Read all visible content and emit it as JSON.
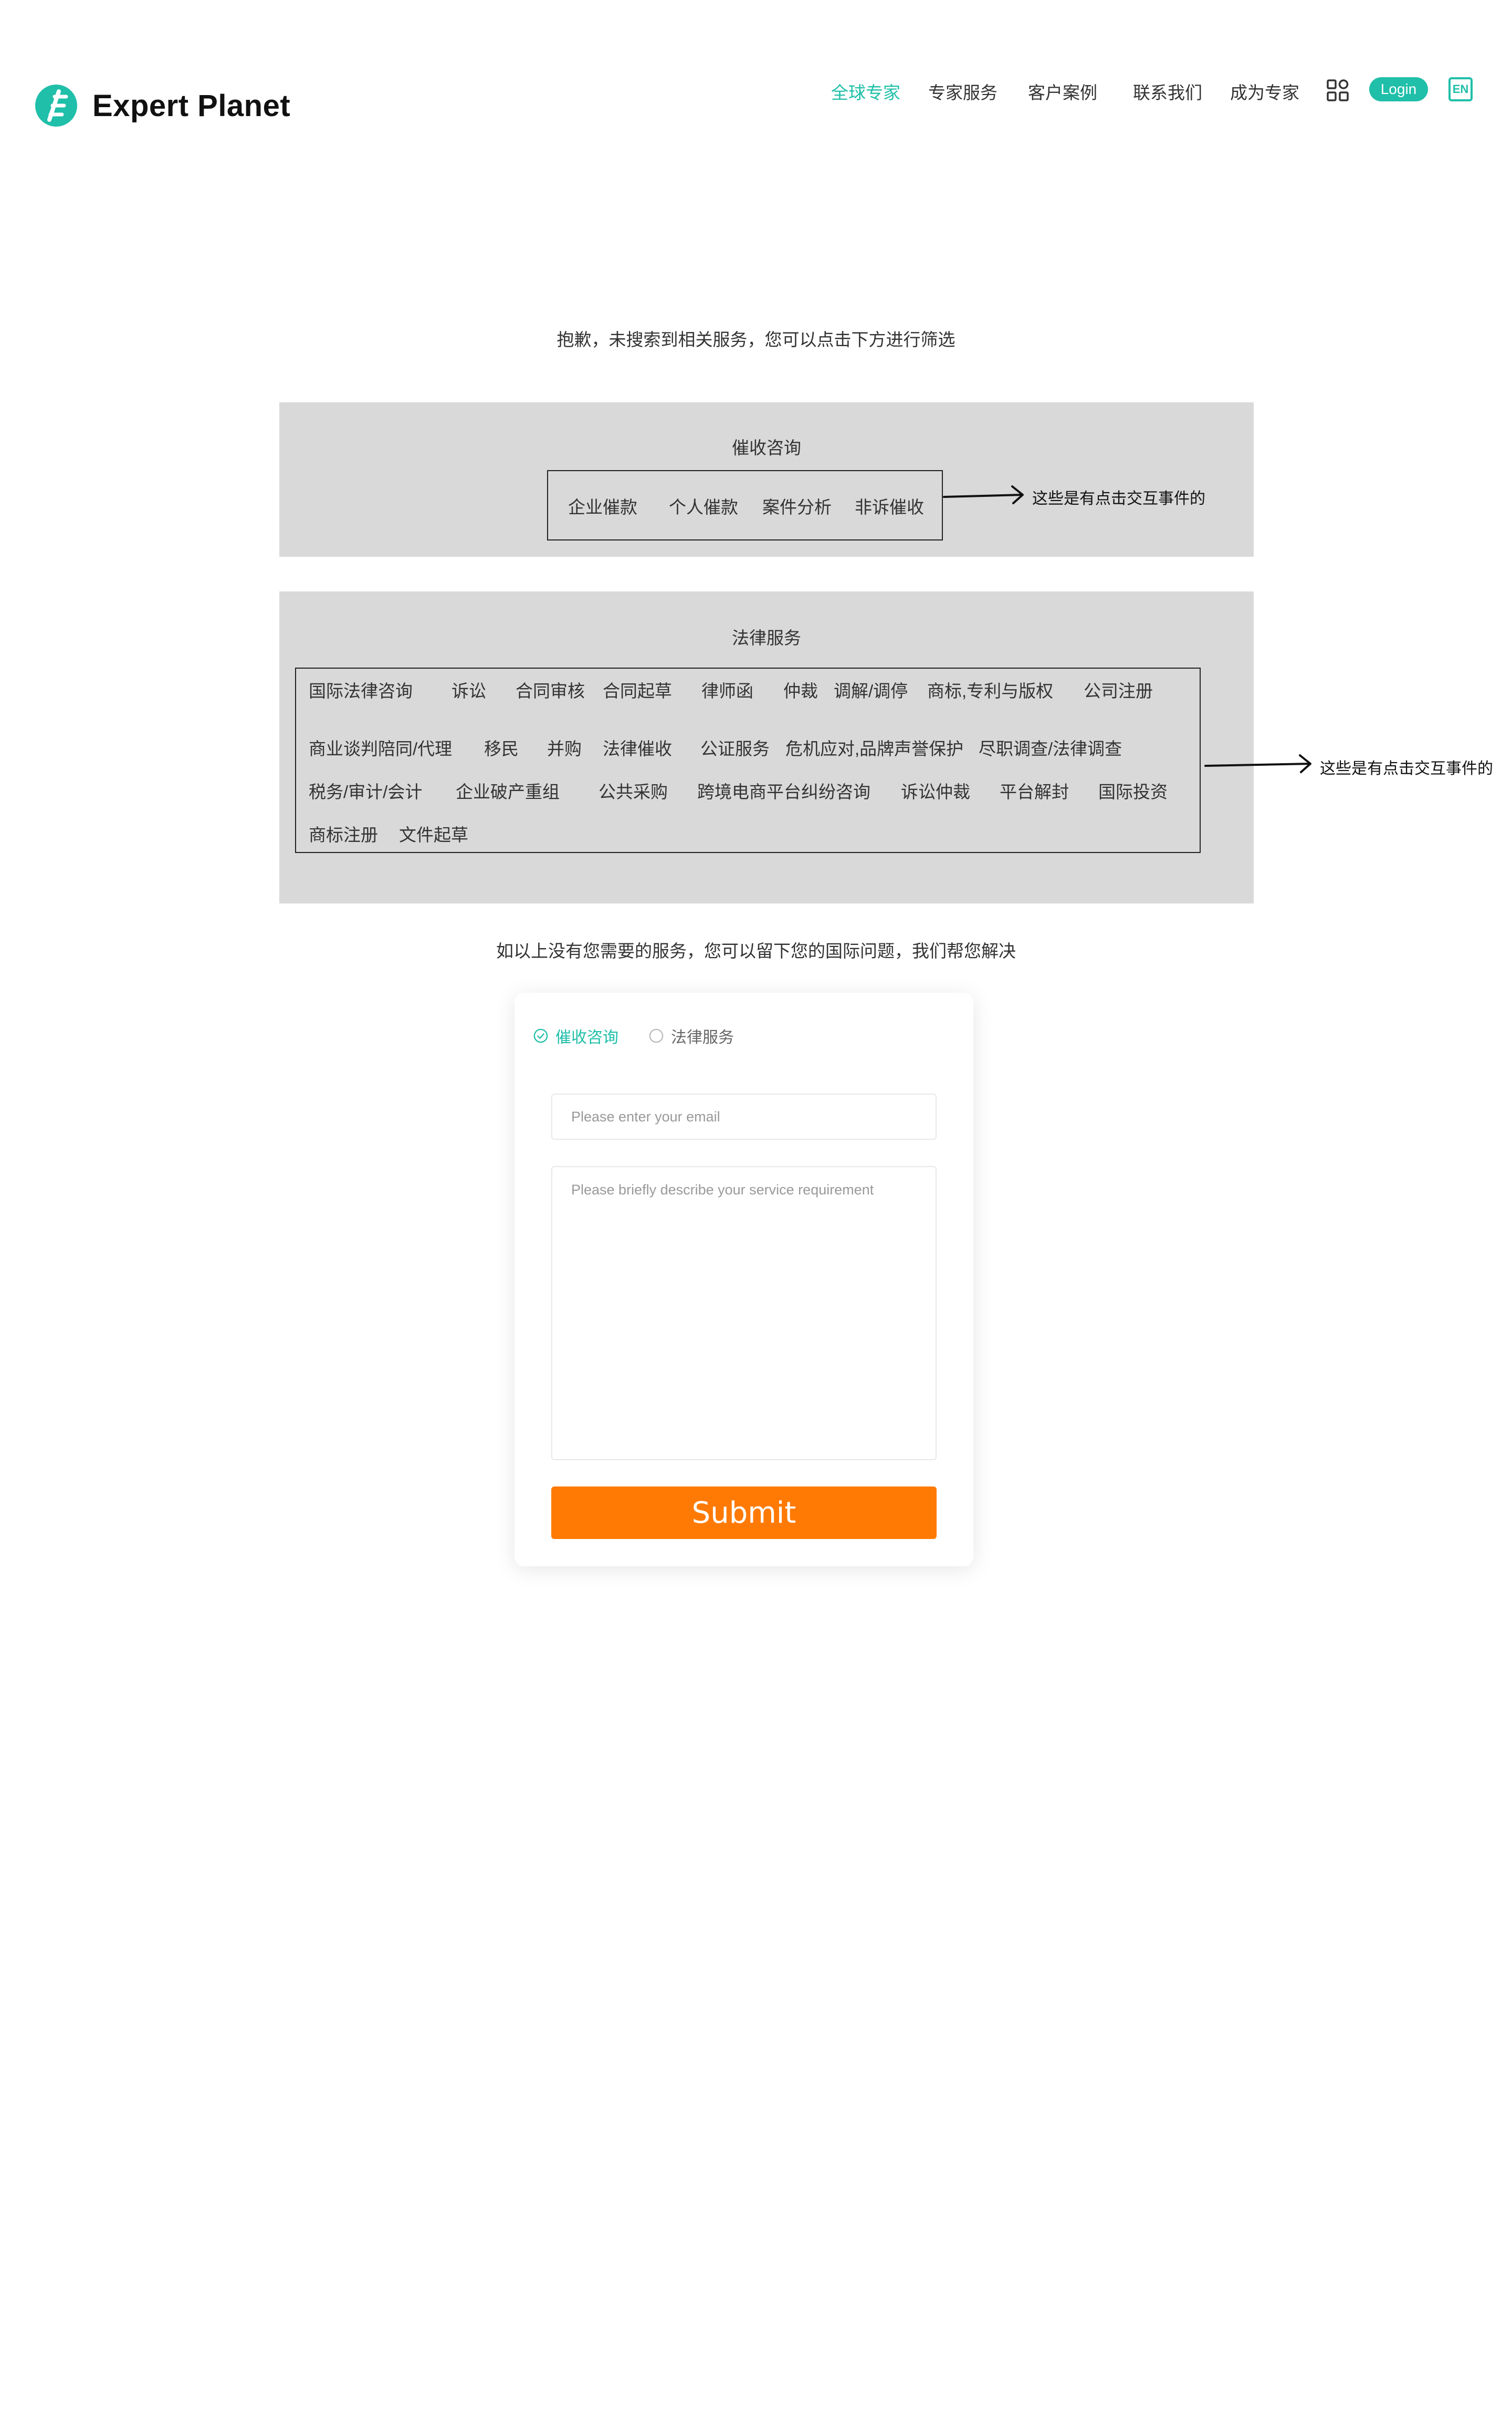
{
  "brand": {
    "name": "Expert Planet",
    "logo_icon": "expert-planet-logo-icon",
    "accent": "#1fbfa9"
  },
  "nav": {
    "items": [
      {
        "label": "全球专家",
        "active": true
      },
      {
        "label": "专家服务",
        "active": false
      },
      {
        "label": "客户案例",
        "active": false
      },
      {
        "label": "联系我们",
        "active": false
      },
      {
        "label": "成为专家",
        "active": false
      }
    ],
    "apps_icon": "apps-grid-icon",
    "login_label": "Login",
    "lang_label": "EN"
  },
  "messages": {
    "no_result": "抱歉，未搜索到相关服务，您可以点击下方进行筛选",
    "fallback": "如以上没有您需要的服务，您可以留下您的国际问题，我们帮您解决"
  },
  "panel_collection": {
    "title": "催收咨询",
    "items": [
      "企业催款",
      "个人催款",
      "案件分析",
      "非诉催收"
    ],
    "annotation": "这些是有点击交互事件的"
  },
  "panel_legal": {
    "title": "法律服务",
    "rows": [
      [
        "国际法律咨询",
        "诉讼",
        "合同审核",
        "合同起草",
        "律师函",
        "仲裁",
        "调解/调停",
        "商标,专利与版权",
        "公司注册"
      ],
      [
        "商业谈判陪同/代理",
        "移民",
        "并购",
        "法律催收",
        "公证服务",
        "危机应对,品牌声誉保护",
        "尽职调查/法律调查"
      ],
      [
        "税务/审计/会计",
        "企业破产重组",
        "公共采购",
        "跨境电商平台纠纷咨询",
        "诉讼仲裁",
        "平台解封",
        "国际投资"
      ],
      [
        "商标注册",
        "文件起草"
      ]
    ],
    "annotation": "这些是有点击交互事件的"
  },
  "form": {
    "radio_options": [
      {
        "label": "催收咨询",
        "selected": true
      },
      {
        "label": "法律服务",
        "selected": false
      }
    ],
    "email_placeholder": "Please enter your email",
    "email_value": "",
    "requirement_placeholder": "Please briefly describe your service requirement",
    "requirement_value": "",
    "submit_label": "Submit",
    "submit_color": "#ff7a05"
  }
}
